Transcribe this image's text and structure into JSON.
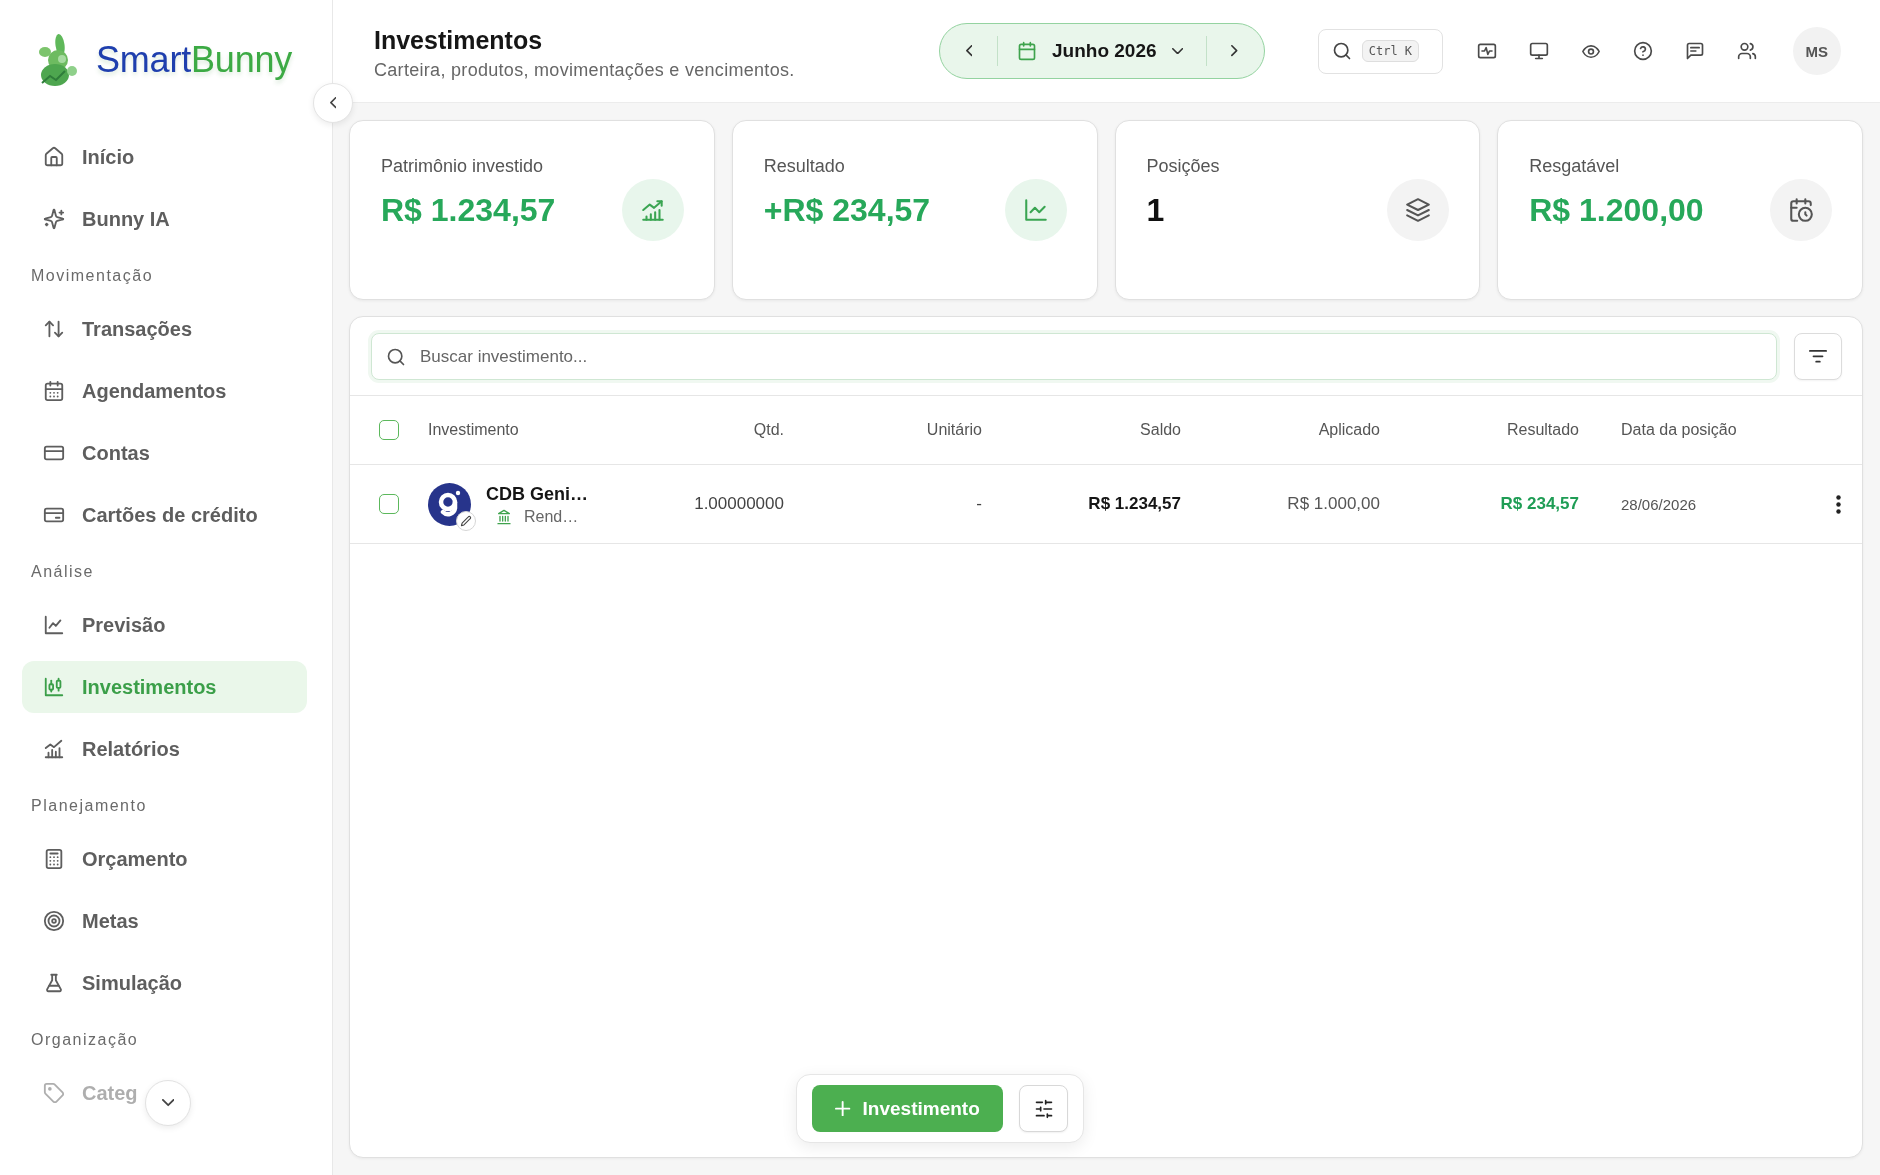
{
  "sidebar": {
    "logo": {
      "parts": [
        "Smart",
        "Bunny"
      ]
    },
    "sections": [
      {
        "items": [
          {
            "label": "Início",
            "selected": false
          },
          {
            "label": "Bunny IA",
            "selected": false
          }
        ]
      },
      {
        "title": "Movimentação",
        "items": [
          {
            "label": "Transações",
            "selected": false
          },
          {
            "label": "Agendamentos",
            "selected": false
          },
          {
            "label": "Contas",
            "selected": false
          },
          {
            "label": "Cartões de crédito",
            "selected": false
          }
        ]
      },
      {
        "title": "Análise",
        "items": [
          {
            "label": "Previsão",
            "selected": false
          },
          {
            "label": "Investimentos",
            "selected": true
          },
          {
            "label": "Relatórios",
            "selected": false
          }
        ]
      },
      {
        "title": "Planejamento",
        "items": [
          {
            "label": "Orçamento",
            "selected": false
          },
          {
            "label": "Metas",
            "selected": false
          },
          {
            "label": "Simulação",
            "selected": false
          }
        ]
      },
      {
        "title": "Organização",
        "items": [
          {
            "label": "Categ",
            "selected": false
          }
        ]
      }
    ]
  },
  "header": {
    "title": "Investimentos",
    "subtitle": "Carteira, produtos, movimentações e vencimentos.",
    "period": "Junho 2026",
    "search_shortcut": "Ctrl K",
    "avatar_initials": "MS"
  },
  "stats": [
    {
      "label": "Patrimônio investido",
      "value": "R$ 1.234,57",
      "kind": "money",
      "accent": true
    },
    {
      "label": "Resultado",
      "value": "+R$ 234,57",
      "kind": "money",
      "accent": true
    },
    {
      "label": "Posições",
      "value": "1",
      "kind": "count",
      "accent": false
    },
    {
      "label": "Resgatável",
      "value": "R$ 1.200,00",
      "kind": "money",
      "accent": false
    }
  ],
  "investments": {
    "search": {
      "placeholder": "Buscar investimento..."
    },
    "table": {
      "select_all": {
        "checked": false
      },
      "columns": [
        "Investimento",
        "Qtd.",
        "Unitário",
        "Saldo",
        "Aplicado",
        "Resultado",
        "Data da posição"
      ],
      "rows": [
        {
          "selected": false,
          "name": "CDB Geni…",
          "type": "Rend…",
          "quantity": "1.00000000",
          "unit_price": "-",
          "balance": "R$ 1.234,57",
          "applied": "R$ 1.000,00",
          "result": "R$ 234,57",
          "result_positive": true,
          "position_date": "28/06/2026"
        }
      ]
    }
  },
  "action_bar": {
    "add_button": "Investimento"
  }
}
